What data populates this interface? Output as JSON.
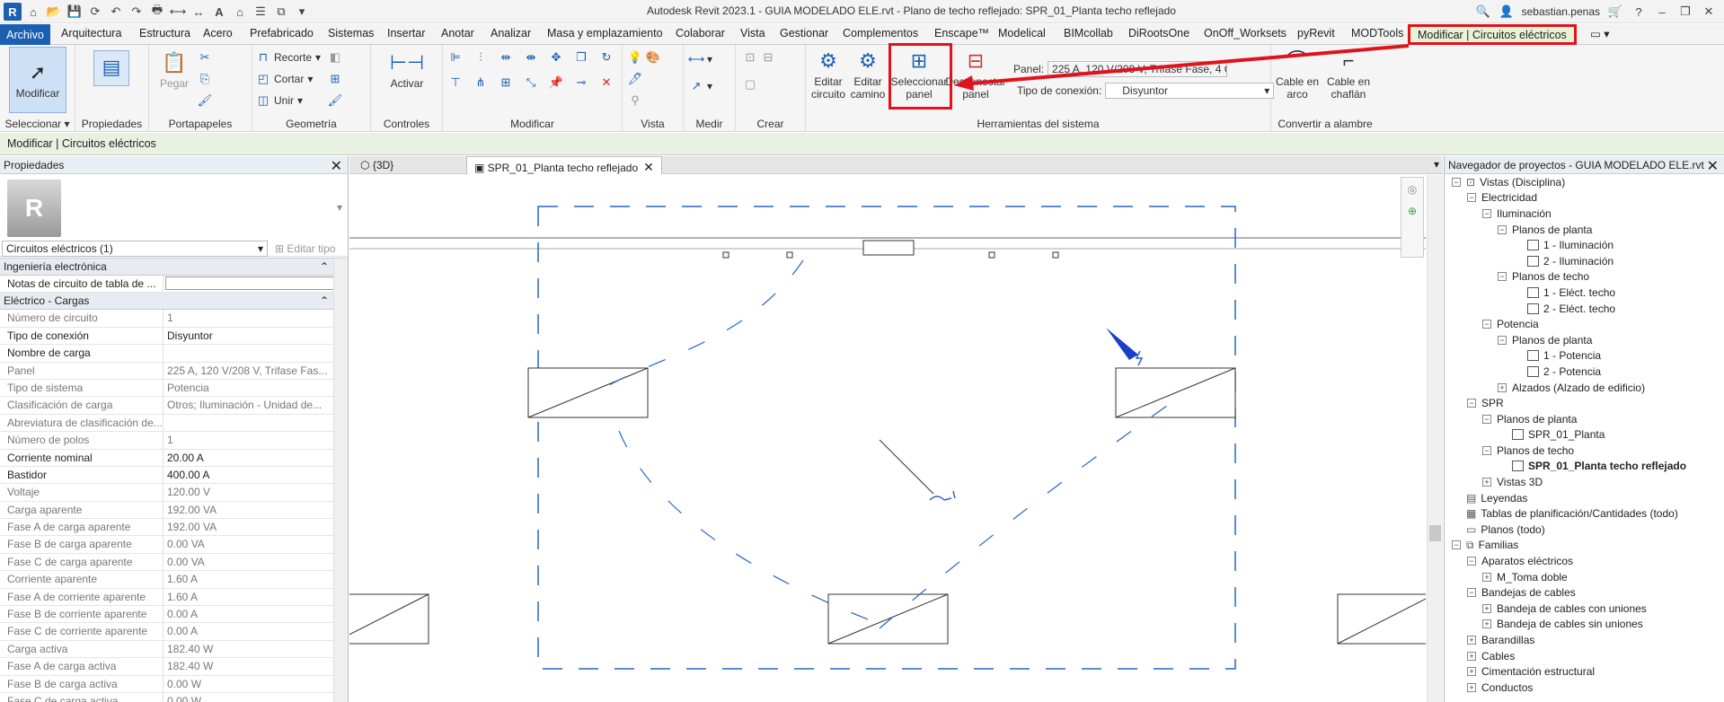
{
  "title_bar": {
    "app_title": "Autodesk Revit 2023.1 - GUIA MODELADO ELE.rvt - Plano de techo reflejado: SPR_01_Planta techo reflejado",
    "user": "sebastian.penas"
  },
  "ribbon_tabs": {
    "file": "Archivo",
    "items": [
      "Arquitectura",
      "Estructura",
      "Acero",
      "Prefabricado",
      "Sistemas",
      "Insertar",
      "Anotar",
      "Analizar",
      "Masa y emplazamiento",
      "Colaborar",
      "Vista",
      "Gestionar",
      "Complementos",
      "Enscape™",
      "Modelical",
      "BIMcollab",
      "DiRootsOne",
      "OnOff_Worksets",
      "pyRevit",
      "MODTools"
    ],
    "contextual": "Modificar | Circuitos eléctricos"
  },
  "ribbon": {
    "panels": {
      "seleccionar": "Seleccionar",
      "propiedades": "Propiedades",
      "portapapeles": "Portapapeles",
      "geometria": "Geometría",
      "controles": "Controles",
      "modificar": "Modificar",
      "vista": "Vista",
      "medir": "Medir",
      "crear": "Crear",
      "herramientas": "Herramientas del sistema",
      "convertir": "Convertir a alambre"
    },
    "buttons": {
      "modificar": "Modificar",
      "pegar": "Pegar",
      "recorte": "Recorte",
      "cortar": "Cortar",
      "unir": "Unir",
      "activar": "Activar",
      "editar_circuito": "Editar circuito",
      "editar_camino": "Editar camino",
      "seleccionar_panel": "Seleccionar panel",
      "desconectar_panel": "Desconectar panel",
      "cable_arco": "Cable en arco",
      "cable_chaflan": "Cable en chaflán"
    },
    "panel_label": "Panel:",
    "panel_value": "225 A, 120 V/208 V, Trifase Fase, 4 Cables,...",
    "conexion_label": "Tipo de conexión:",
    "conexion_value": "Disyuntor"
  },
  "options_bar": {
    "text": "Modificar | Circuitos eléctricos"
  },
  "properties": {
    "title": "Propiedades",
    "selector": "Circuitos eléctricos (1)",
    "edit_type": "Editar tipo",
    "categories": [
      {
        "name": "Ingeniería electrónica",
        "rows": [
          {
            "k": "Notas de circuito de tabla de ...",
            "v": "",
            "ro": false
          }
        ]
      },
      {
        "name": "Eléctrico - Cargas",
        "rows": [
          {
            "k": "Número de circuito",
            "v": "1",
            "ro": true
          },
          {
            "k": "Tipo de conexión",
            "v": "Disyuntor",
            "ro": false
          },
          {
            "k": "Nombre de carga",
            "v": "",
            "ro": false
          },
          {
            "k": "Panel",
            "v": "225 A, 120 V/208 V, Trifase Fas...",
            "ro": true
          },
          {
            "k": "Tipo de sistema",
            "v": "Potencia",
            "ro": true
          },
          {
            "k": "Clasificación de carga",
            "v": "Otros; Iluminación - Unidad de...",
            "ro": true
          },
          {
            "k": "Abreviatura de clasificación de...",
            "v": "",
            "ro": true
          },
          {
            "k": "Número de polos",
            "v": "1",
            "ro": true
          },
          {
            "k": "Corriente nominal",
            "v": "20.00 A",
            "ro": false
          },
          {
            "k": "Bastidor",
            "v": "400.00 A",
            "ro": false
          },
          {
            "k": "Voltaje",
            "v": "120.00 V",
            "ro": true
          },
          {
            "k": "Carga aparente",
            "v": "192.00 VA",
            "ro": true
          },
          {
            "k": "Fase A de carga aparente",
            "v": "192.00 VA",
            "ro": true
          },
          {
            "k": "Fase B de carga aparente",
            "v": "0.00 VA",
            "ro": true
          },
          {
            "k": "Fase C de carga aparente",
            "v": "0.00 VA",
            "ro": true
          },
          {
            "k": "Corriente aparente",
            "v": "1.60 A",
            "ro": true
          },
          {
            "k": "Fase A de corriente aparente",
            "v": "1.60 A",
            "ro": true
          },
          {
            "k": "Fase B de corriente aparente",
            "v": "0.00 A",
            "ro": true
          },
          {
            "k": "Fase C de corriente aparente",
            "v": "0.00 A",
            "ro": true
          },
          {
            "k": "Carga activa",
            "v": "182.40 W",
            "ro": true
          },
          {
            "k": "Fase A de carga activa",
            "v": "182.40 W",
            "ro": true
          },
          {
            "k": "Fase B de carga activa",
            "v": "0.00 W",
            "ro": true
          },
          {
            "k": "Fase C de carga activa",
            "v": "0.00 W",
            "ro": true
          }
        ]
      }
    ]
  },
  "view_tabs": [
    {
      "label": "{3D}",
      "active": false
    },
    {
      "label": "SPR_01_Planta techo reflejado",
      "active": true
    }
  ],
  "browser": {
    "title": "Navegador de proyectos - GUIA MODELADO ELE.rvt",
    "tree": [
      {
        "label": "Vistas (Disciplina)",
        "level": 0,
        "toggle": "-",
        "icon": "views"
      },
      {
        "label": "Electricidad",
        "level": 1,
        "toggle": "-"
      },
      {
        "label": "Iluminación",
        "level": 2,
        "toggle": "-"
      },
      {
        "label": "Planos de planta",
        "level": 3,
        "toggle": "-"
      },
      {
        "label": "1 - Iluminación",
        "level": 4,
        "icon": "view"
      },
      {
        "label": "2 - Iluminación",
        "level": 4,
        "icon": "view"
      },
      {
        "label": "Planos de techo",
        "level": 3,
        "toggle": "-"
      },
      {
        "label": "1 - Eléct. techo",
        "level": 4,
        "icon": "view"
      },
      {
        "label": "2 - Eléct. techo",
        "level": 4,
        "icon": "view"
      },
      {
        "label": "Potencia",
        "level": 2,
        "toggle": "-"
      },
      {
        "label": "Planos de planta",
        "level": 3,
        "toggle": "-"
      },
      {
        "label": "1 - Potencia",
        "level": 4,
        "icon": "view"
      },
      {
        "label": "2 - Potencia",
        "level": 4,
        "icon": "view"
      },
      {
        "label": "Alzados (Alzado de edificio)",
        "level": 3,
        "toggle": "+"
      },
      {
        "label": "SPR",
        "level": 1,
        "toggle": "-"
      },
      {
        "label": "Planos de planta",
        "level": 2,
        "toggle": "-"
      },
      {
        "label": "SPR_01_Planta",
        "level": 3,
        "icon": "view"
      },
      {
        "label": "Planos de techo",
        "level": 2,
        "toggle": "-"
      },
      {
        "label": "SPR_01_Planta techo reflejado",
        "level": 3,
        "icon": "view",
        "bold": true
      },
      {
        "label": "Vistas 3D",
        "level": 2,
        "toggle": "+"
      },
      {
        "label": "Leyendas",
        "level": 0,
        "icon": "legend"
      },
      {
        "label": "Tablas de planificación/Cantidades (todo)",
        "level": 0,
        "icon": "table"
      },
      {
        "label": "Planos (todo)",
        "level": 0,
        "icon": "sheet"
      },
      {
        "label": "Familias",
        "level": 0,
        "toggle": "-",
        "icon": "family"
      },
      {
        "label": "Aparatos eléctricos",
        "level": 1,
        "toggle": "-"
      },
      {
        "label": "M_Toma doble",
        "level": 2,
        "toggle": "+"
      },
      {
        "label": "Bandejas de cables",
        "level": 1,
        "toggle": "-"
      },
      {
        "label": "Bandeja de cables con uniones",
        "level": 2,
        "toggle": "+"
      },
      {
        "label": "Bandeja de cables sin uniones",
        "level": 2,
        "toggle": "+"
      },
      {
        "label": "Barandillas",
        "level": 1,
        "toggle": "+"
      },
      {
        "label": "Cables",
        "level": 1,
        "toggle": "+"
      },
      {
        "label": "Cimentación estructural",
        "level": 1,
        "toggle": "+"
      },
      {
        "label": "Conductos",
        "level": 1,
        "toggle": "+"
      }
    ]
  },
  "colors": {
    "accent": "#1b5fb3",
    "highlight": "#e1121c",
    "context_tab": "#e8f3d6",
    "wire": "#2962c9"
  }
}
